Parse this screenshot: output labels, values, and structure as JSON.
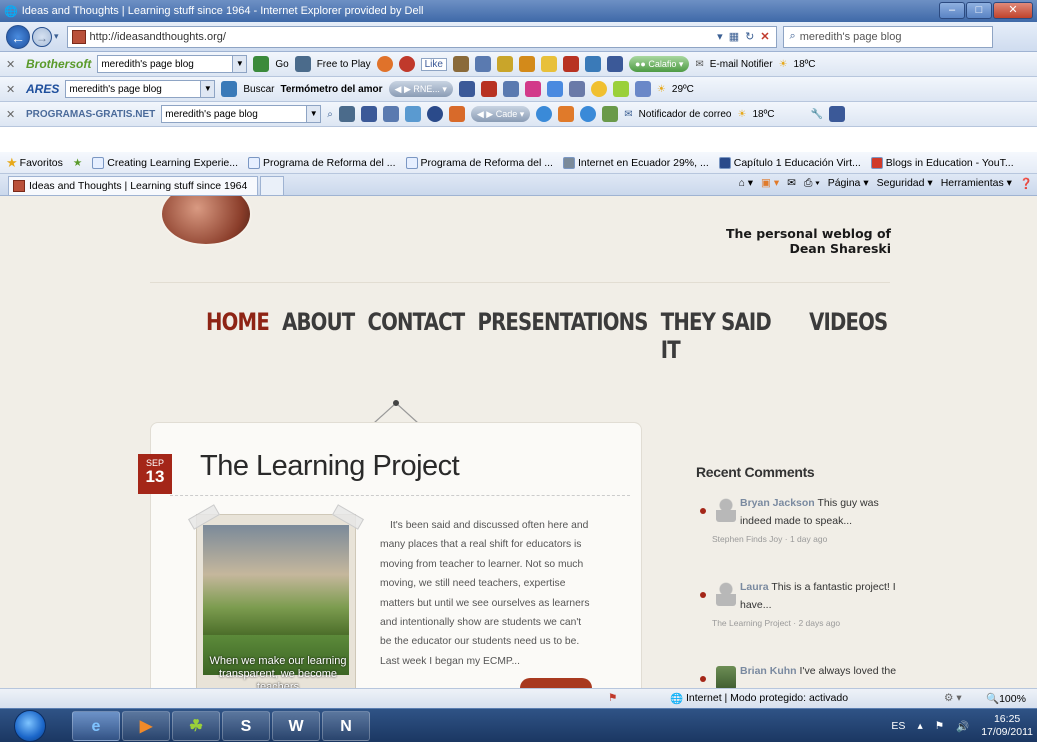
{
  "window": {
    "title": "Ideas and Thoughts | Learning stuff since 1964 - Internet Explorer provided by Dell"
  },
  "address_bar": {
    "url": "http://ideasandthoughts.org/",
    "search_text": "meredith's page blog"
  },
  "toolbars": [
    {
      "brand": "Brothersoft",
      "search": "meredith's page blog",
      "items": [
        "Go",
        "Free to Play",
        "Like",
        "E-mail Notifier",
        "18ºC"
      ]
    },
    {
      "brand": "ARES",
      "search": "meredith's page blog",
      "items": [
        "Buscar",
        "Termómetro del amor",
        "RNE...",
        "29ºC"
      ]
    },
    {
      "brand": "PROGRAMAS-GRATIS.NET",
      "search": "meredith's page blog",
      "items": [
        "Cade",
        "Notificador de correo",
        "18ºC"
      ]
    }
  ],
  "favorites": {
    "label": "Favoritos",
    "items": [
      "Creating Learning Experie...",
      "Programa de Reforma del ...",
      "Programa de Reforma del ...",
      "Internet en Ecuador 29%, ...",
      "Capítulo 1 Educación Virt...",
      "Blogs in Education - YouT..."
    ]
  },
  "tab": {
    "title": "Ideas and Thoughts | Learning stuff since 1964"
  },
  "command_bar": {
    "page": "Página",
    "safety": "Seguridad",
    "tools": "Herramientas"
  },
  "site": {
    "tagline_1": "The personal weblog of",
    "tagline_2": "Dean Shareski",
    "nav": [
      "HOME",
      "ABOUT",
      "CONTACT",
      "PRESENTATIONS",
      "THEY SAID IT",
      "VIDEOS"
    ],
    "post": {
      "month": "SEP",
      "day": "13",
      "title": "The Learning Project",
      "photo_caption": "When we make our learning transparent, we become teachers",
      "excerpt": "It's been said and discussed often here and many places that a real shift for educators is moving from teacher to learner. Not so much moving, we still need teachers, expertise matters but until we see ourselves as learners and intentionally show are students we can't be the educator our students need us to be.  Last week I began my ECMP..."
    },
    "sidebar": {
      "title": "Recent Comments",
      "comments": [
        {
          "author": "Bryan Jackson",
          "text": "This guy was indeed made to speak...",
          "meta": "Stephen Finds Joy · 1 day ago"
        },
        {
          "author": "Laura",
          "text": "This is a fantastic project! I have...",
          "meta": "The Learning Project · 2 days ago"
        },
        {
          "author": "Brian Kuhn",
          "text": "I've always loved the",
          "meta": ""
        }
      ]
    }
  },
  "status_bar": {
    "zone": "Internet | Modo protegido: activado",
    "zoom": "100%"
  },
  "taskbar": {
    "lang": "ES",
    "time": "16:25",
    "date": "17/09/2011"
  }
}
